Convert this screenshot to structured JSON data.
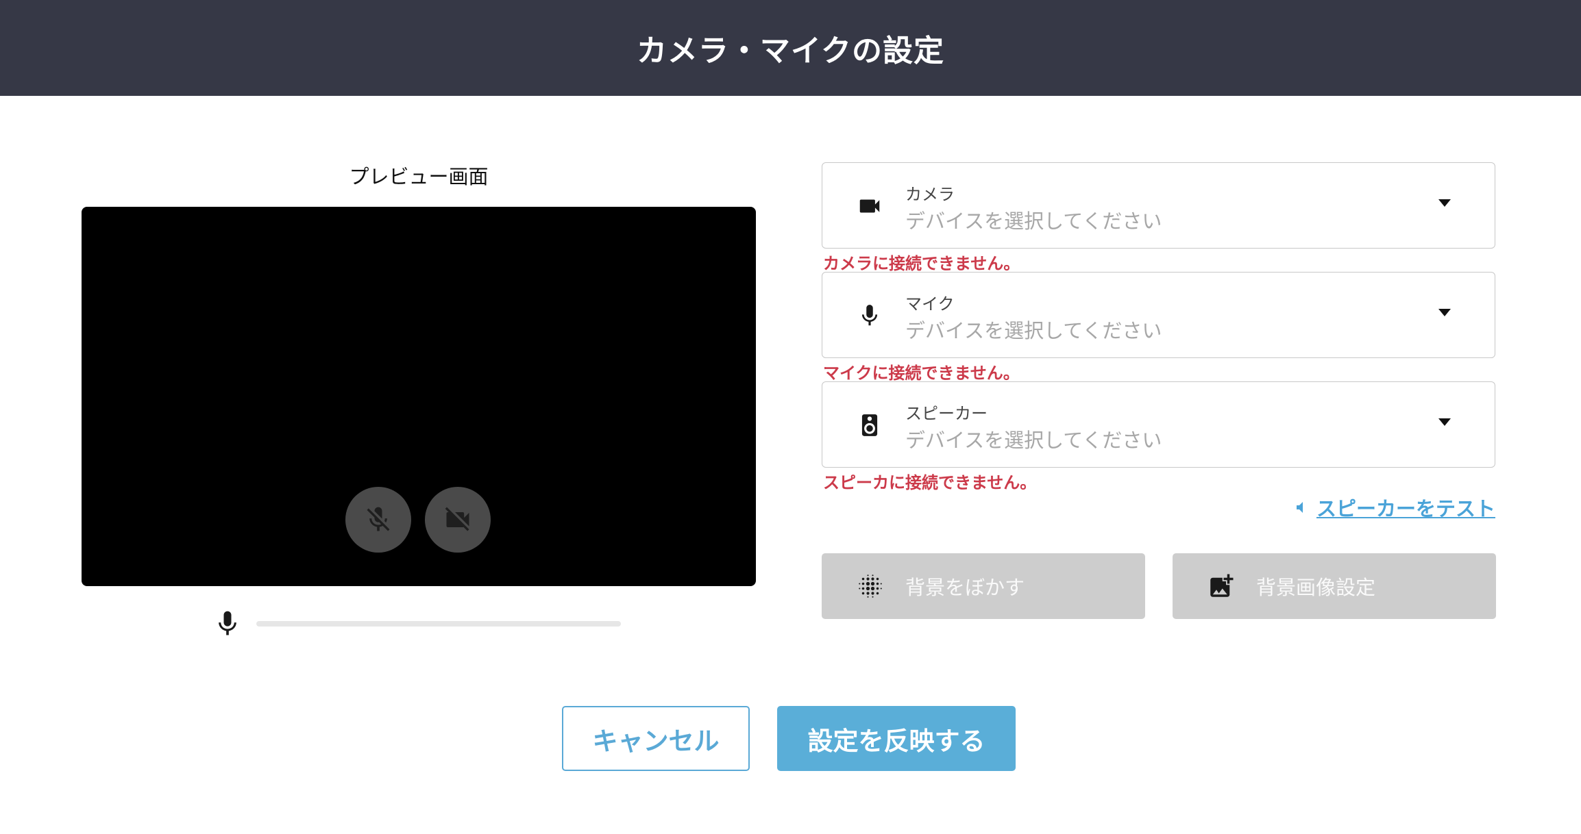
{
  "header": {
    "title": "カメラ・マイクの設定"
  },
  "preview": {
    "label": "プレビュー画面",
    "mic_level": 0
  },
  "devices": [
    {
      "label": "カメラ",
      "placeholder": "デバイスを選択してください",
      "icon": "videocam-icon",
      "error": "カメラに接続できません。"
    },
    {
      "label": "マイク",
      "placeholder": "デバイスを選択してください",
      "icon": "mic-icon",
      "error": "マイクに接続できません。"
    },
    {
      "label": "スピーカー",
      "placeholder": "デバイスを選択してください",
      "icon": "speaker-icon",
      "error": "スピーカに接続できません。"
    }
  ],
  "speaker_test": {
    "label": "スピーカーをテスト"
  },
  "background": {
    "blur_label": "背景をぼかす",
    "image_label": "背景画像設定"
  },
  "actions": {
    "cancel_label": "キャンセル",
    "apply_label": "設定を反映する"
  },
  "colors": {
    "header_bg": "#363846",
    "accent": "#5aa9d6",
    "error": "#cc3a4a",
    "disabled_button": "#cdcdcd"
  }
}
